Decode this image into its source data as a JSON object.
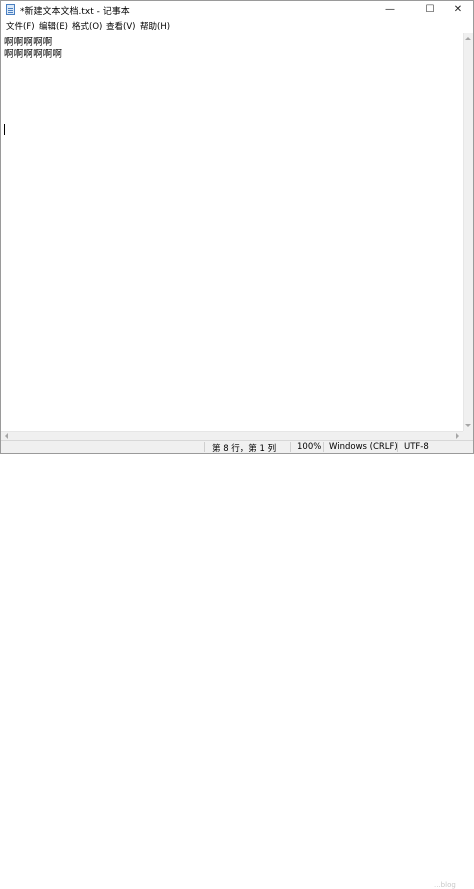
{
  "window": {
    "title": "*新建文本文档.txt - 记事本",
    "controls": {
      "minimize": "—",
      "maximize": "☐",
      "close": "✕"
    }
  },
  "menu": [
    "文件(F)",
    "编辑(E)",
    "格式(O)",
    "查看(V)",
    "帮助(H)"
  ],
  "editor": {
    "lines": [
      "啊啊啊啊啊",
      "啊啊啊啊啊啊"
    ]
  },
  "status": {
    "position": "第 8 行，第 1 列",
    "zoom": "100%",
    "line_ending": "Windows (CRLF)",
    "encoding": "UTF-8"
  },
  "watermark": "...blog"
}
